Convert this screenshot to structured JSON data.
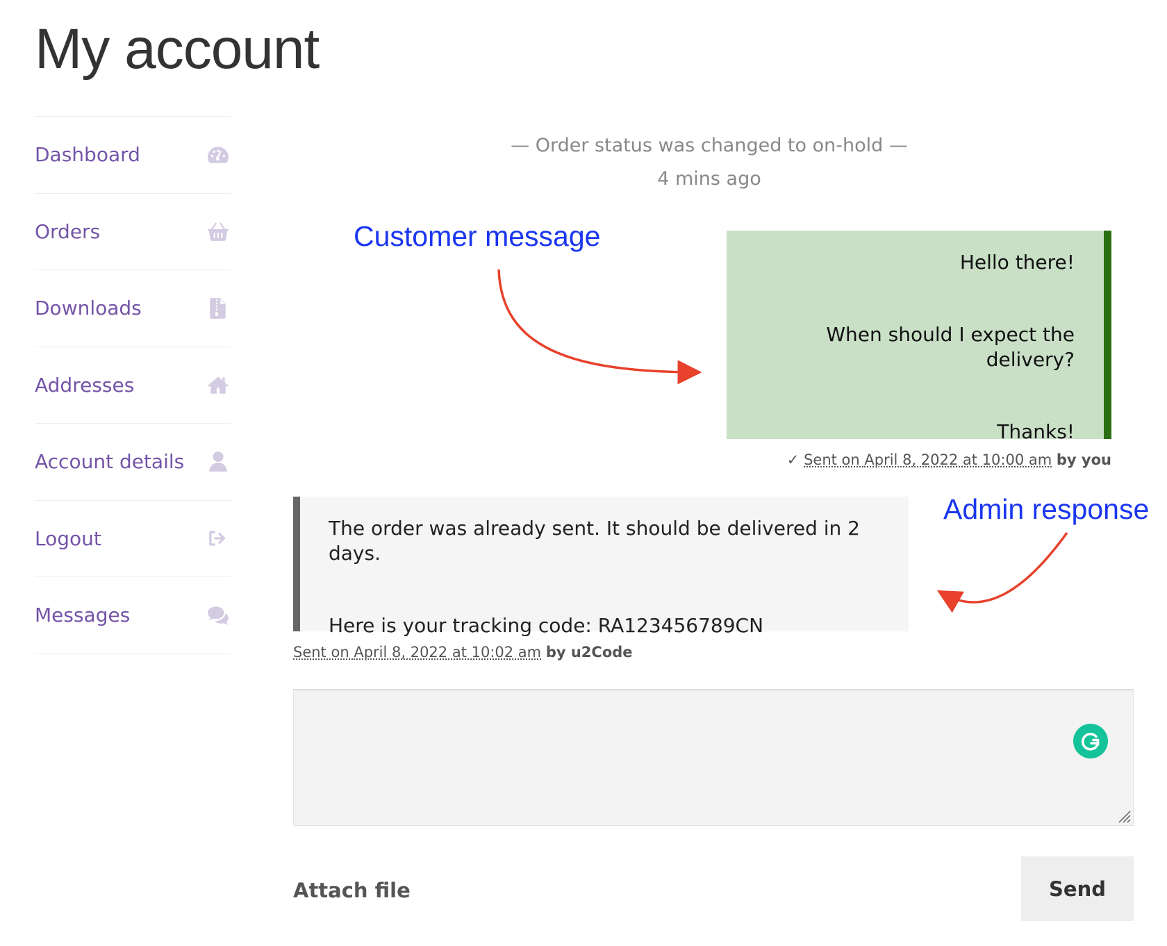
{
  "page": {
    "title": "My account"
  },
  "sidebar": {
    "items": [
      {
        "label": "Dashboard",
        "icon": "dashboard-icon"
      },
      {
        "label": "Orders",
        "icon": "basket-icon"
      },
      {
        "label": "Downloads",
        "icon": "file-archive-icon"
      },
      {
        "label": "Addresses",
        "icon": "home-icon"
      },
      {
        "label": "Account details",
        "icon": "user-icon"
      },
      {
        "label": "Logout",
        "icon": "sign-out-icon"
      },
      {
        "label": "Messages",
        "icon": "comments-icon"
      }
    ]
  },
  "timeline": {
    "status_text": "— Order status was changed to on-hold —",
    "status_time": "4 mins ago"
  },
  "annotations": {
    "customer_label": "Customer message",
    "admin_label": "Admin response",
    "color": "#1a36f0",
    "arrow_color": "#e8412c"
  },
  "customer_message": {
    "lines": [
      "Hello there!",
      "When should I expect the delivery?",
      "Thanks!"
    ],
    "check": "✓",
    "sent_prefix": "Sent on",
    "sent_date": "April 8, 2022 at 10:00 am",
    "by": "by you",
    "background": "#c9e0c7",
    "border_color": "#2c6e12"
  },
  "admin_message": {
    "lines": [
      "The order was already sent. It should be delivered in 2 days.",
      "Here is your tracking code: RA123456789CN"
    ],
    "sent_prefix": "Sent on",
    "sent_date": "April 8, 2022 at 10:02 am",
    "by": "by u2Code"
  },
  "reply": {
    "placeholder": "",
    "value": "",
    "attach_label": "Attach file",
    "send_label": "Send"
  },
  "colors": {
    "nav_link": "#7454a8",
    "nav_icon": "#d3cbe2",
    "grammarly": "#15c39a"
  }
}
